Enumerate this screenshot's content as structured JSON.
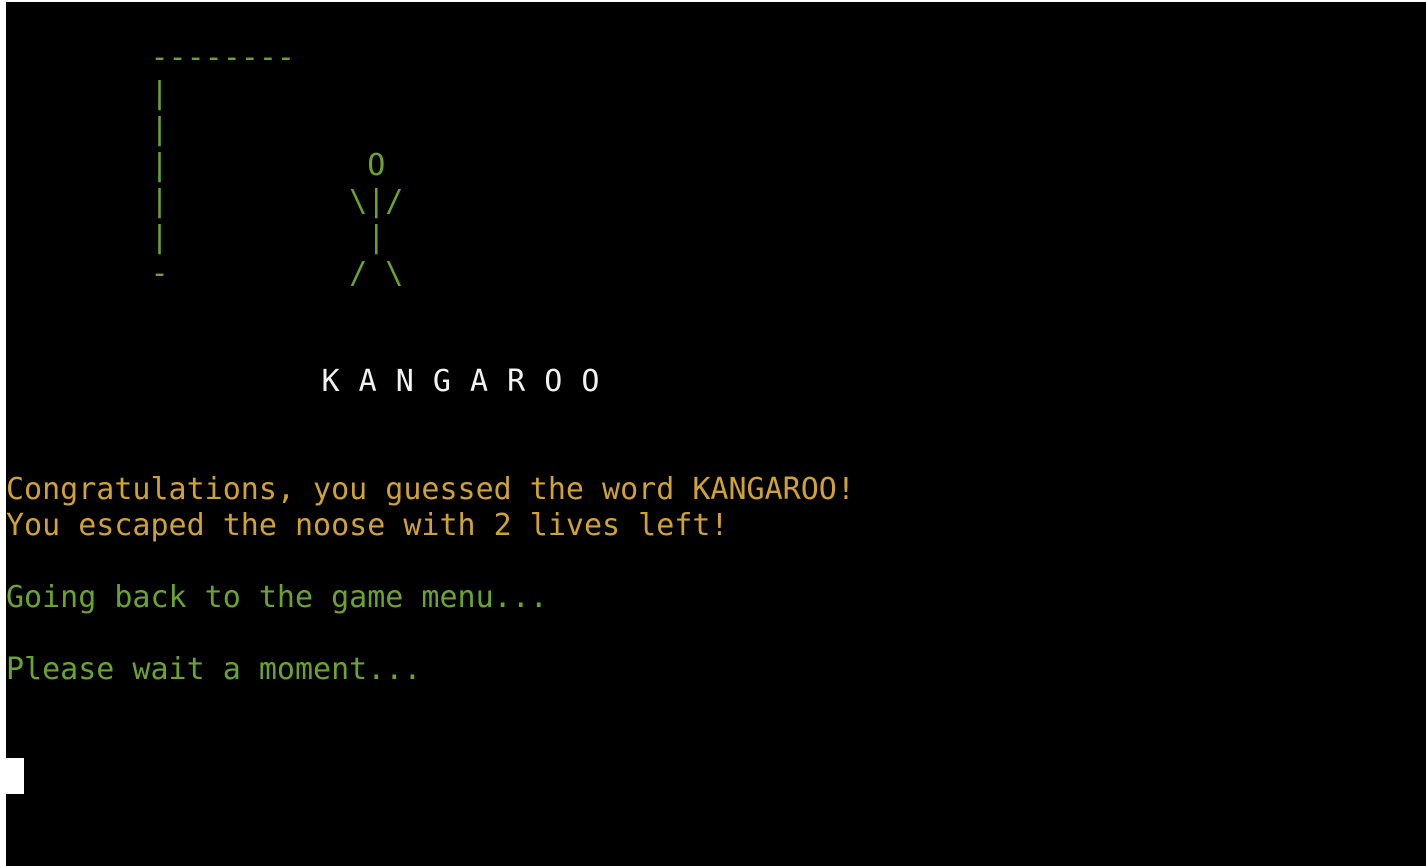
{
  "gallows": {
    "lines": [
      "        --------",
      "        |",
      "        |",
      "        |           O",
      "        |          \\|/",
      "        |           |",
      "        -          / \\"
    ]
  },
  "word_display": "                 K A N G A R O O",
  "messages": {
    "congrats": "Congratulations, you guessed the word KANGAROO!",
    "lives": "You escaped the noose with 2 lives left!",
    "going_back": "Going back to the game menu...",
    "please_wait": "Please wait a moment..."
  },
  "colors": {
    "background": "#000000",
    "green": "#6aa42f",
    "gold": "#cfa233",
    "white": "#f2f2f2"
  }
}
